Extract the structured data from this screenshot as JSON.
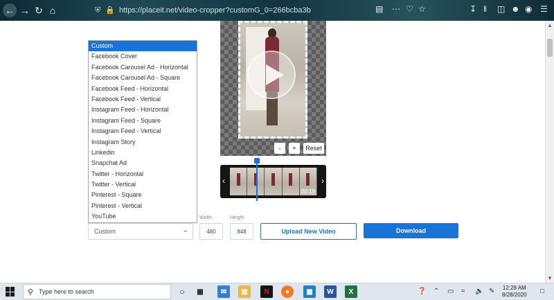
{
  "browser": {
    "url": "https://placeit.net/video-cropper?customG_0=266bcba3b",
    "url_domain": "placeit.net"
  },
  "cropper": {
    "options": [
      "Custom",
      "Facebook Cover",
      "Facebook Carousel Ad - Horizontal",
      "Facebook Carousel Ad - Square",
      "Facebook Feed - Horizontal",
      "Facebook Feed - Vertical",
      "Instagram Feed - Horizontal",
      "Instagram Feed - Square",
      "Instagram Feed - Vertical",
      "Instagram Story",
      "Linkedin",
      "Snapchat Ad",
      "Twitter - Horizontal",
      "Twitter - Vertical",
      "Pinterest - Square",
      "Pinterest - Vertical",
      "YouTube"
    ],
    "selected_option": "Custom",
    "width_label": "Width",
    "height_label": "Height",
    "width_value": "480",
    "height_value": "848",
    "upload_label": "Upload New Video",
    "download_label": "Download",
    "zoom_minus": "-",
    "zoom_plus": "+",
    "reset_label": "Reset",
    "timeline_time": "00:19",
    "accent_color": "#1a73d9"
  },
  "taskbar": {
    "search_placeholder": "Type here to search",
    "time": "12:28 AM",
    "date": "8/28/2020"
  }
}
